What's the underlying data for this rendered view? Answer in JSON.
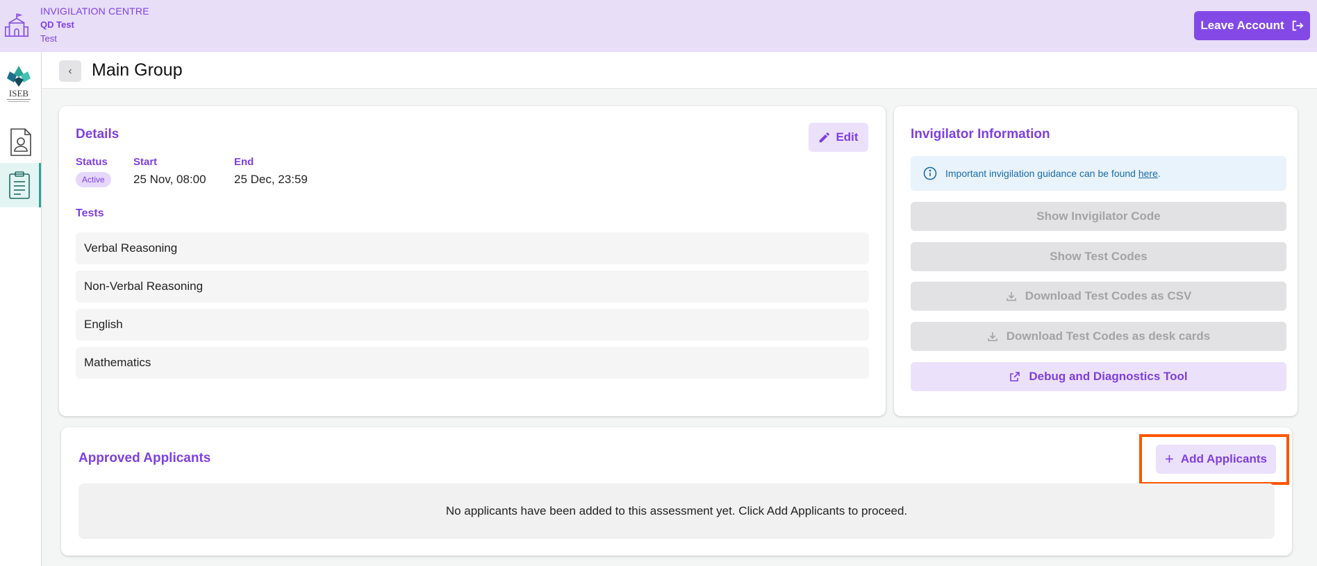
{
  "topbar": {
    "centre_label": "INVIGILATION CENTRE",
    "centre_name": "QD Test",
    "centre_sub": "Test",
    "leave_label": "Leave Account"
  },
  "sidebar": {
    "brand_text": "ISEB"
  },
  "header": {
    "title": "Main Group",
    "back_glyph": "‹"
  },
  "details": {
    "title": "Details",
    "edit_label": "Edit",
    "status_label": "Status",
    "status_value": "Active",
    "start_label": "Start",
    "start_value": "25 Nov, 08:00",
    "end_label": "End",
    "end_value": "25 Dec, 23:59",
    "tests_label": "Tests",
    "tests": [
      "Verbal Reasoning",
      "Non-Verbal Reasoning",
      "English",
      "Mathematics"
    ]
  },
  "invigilator": {
    "title": "Invigilator Information",
    "info_text": "Important invigilation guidance can be found ",
    "info_link": "here",
    "info_end": ".",
    "buttons": {
      "show_code": "Show Invigilator Code",
      "show_test_codes": "Show Test Codes",
      "download_csv": "Download Test Codes as CSV",
      "download_cards": "Download Test Codes as desk cards",
      "debug": "Debug and Diagnostics Tool"
    }
  },
  "applicants": {
    "title": "Approved Applicants",
    "add_label": "Add Applicants",
    "empty_text": "No applicants have been added to this assessment yet. Click Add Applicants to proceed."
  },
  "colors": {
    "accent": "#8349e6",
    "accent_light": "#ece1fb",
    "topbar_bg": "#e8def8",
    "teal": "#2ba597",
    "highlight": "#ff5500"
  }
}
